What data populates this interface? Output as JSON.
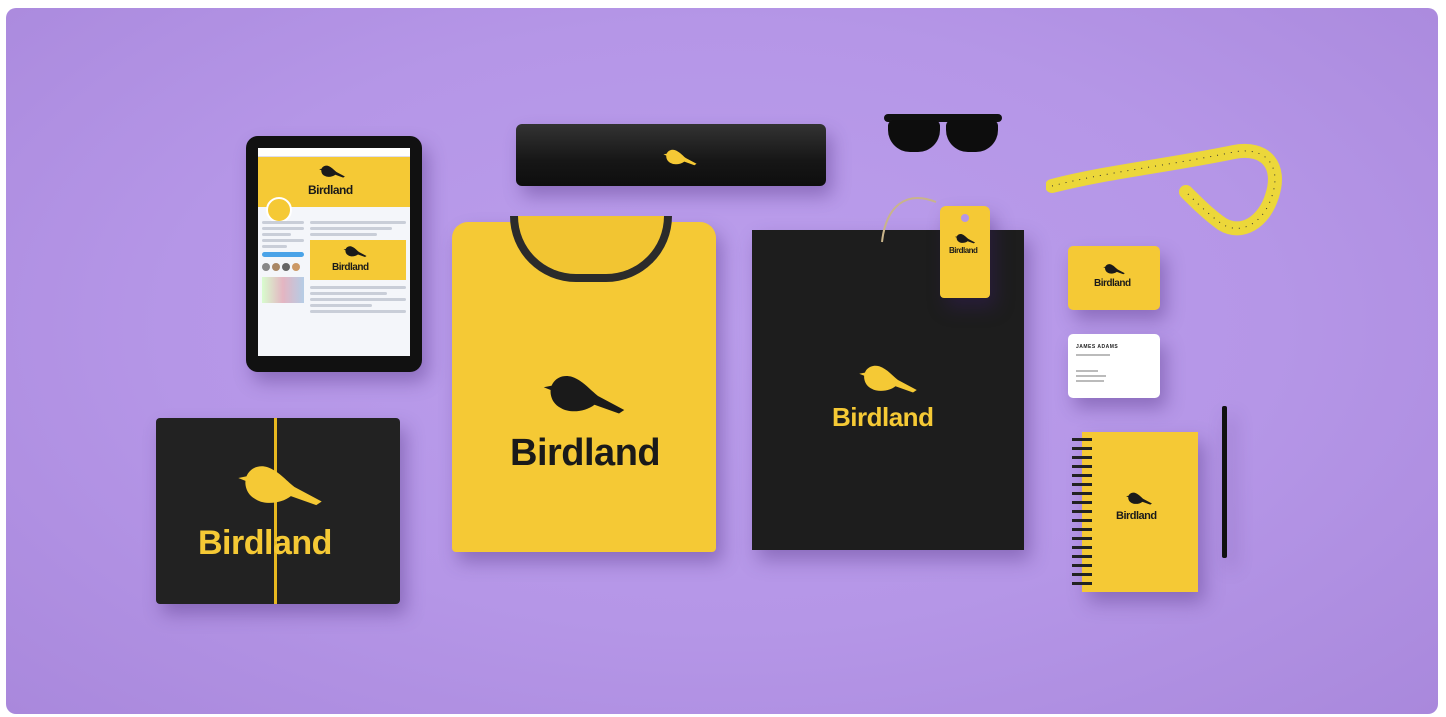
{
  "brand": {
    "name": "Birdland",
    "accent": "#f5c935",
    "dark": "#1d1d1d",
    "background": "#b596e7"
  },
  "card": {
    "name": "JAMES ADAMS"
  },
  "icons": [
    "bird-logo-icon"
  ]
}
